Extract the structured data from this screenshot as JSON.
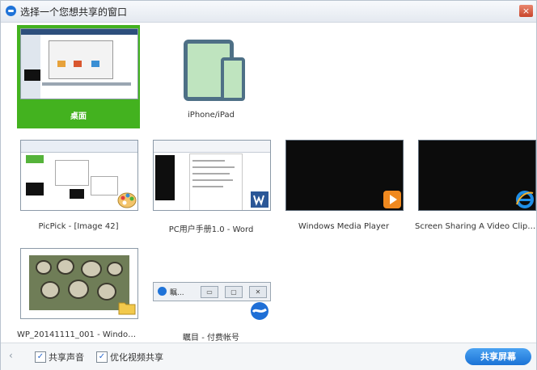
{
  "window": {
    "title": "选择一个您想共享的窗口",
    "close_label": "×"
  },
  "tiles": [
    {
      "label": "桌面",
      "selected": true
    },
    {
      "label": "iPhone/iPad"
    },
    {
      "label": "PicPick - [Image 42]"
    },
    {
      "label": "PC用户手册1.0 - Word"
    },
    {
      "label": "Windows Media Player"
    },
    {
      "label": "Screen Sharing A Video Clip – ..."
    },
    {
      "label": "WP_20141111_001 - Windows ..."
    },
    {
      "label": "瞩目 - 付费帐号"
    }
  ],
  "conference_toolbar": {
    "title": "瞩..."
  },
  "footer": {
    "collapse_arrow": "‹",
    "share_audio": {
      "label": "共享声音",
      "checked": true
    },
    "optimize_video": {
      "label": "优化视频共享",
      "checked": true
    },
    "share_button": "共享屏幕"
  },
  "colors": {
    "selected_tile": "#43b21f",
    "accent": "#1b73d6"
  },
  "badges": [
    "palette-icon",
    "word-icon",
    "media-player-icon",
    "ie-icon",
    "folder-icon",
    "zhumu-icon"
  ]
}
